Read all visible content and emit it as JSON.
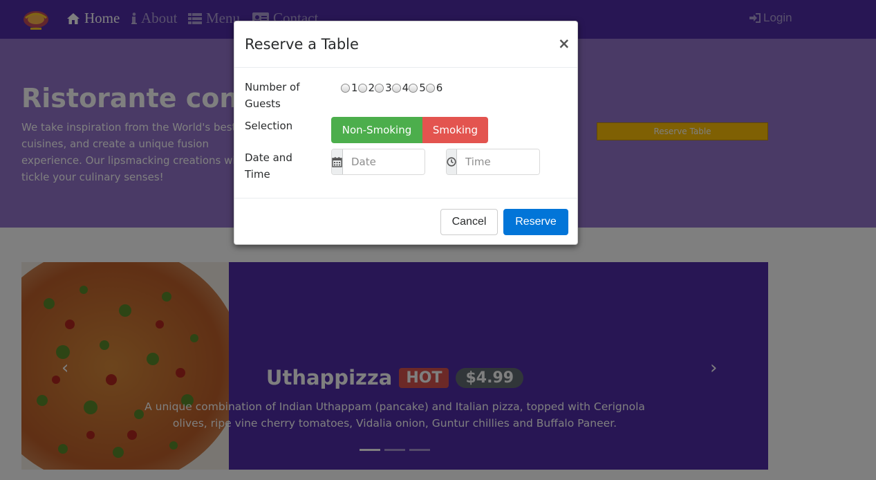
{
  "navbar": {
    "items": [
      {
        "label": "Home",
        "icon": "home-icon"
      },
      {
        "label": "About",
        "icon": "info-icon"
      },
      {
        "label": "Menu",
        "icon": "list-icon"
      },
      {
        "label": "Contact",
        "icon": "address-card-icon"
      }
    ],
    "login_label": "Login"
  },
  "hero": {
    "title": "Ristorante con Fusion",
    "text": "We take inspiration from the World's best cuisines, and create a unique fusion experience. Our lipsmacking creations will tickle your culinary senses!",
    "reserve_button": "Reserve Table"
  },
  "carousel": {
    "dish_name": "Uthappizza",
    "badge_hot": "HOT",
    "price": "$4.99",
    "description": "A unique combination of Indian Uthappam (pancake) and Italian pizza, topped with Cerignola olives, ripe vine cherry tomatoes, Vidalia onion, Guntur chillies and Buffalo Paneer.",
    "active_slide": 1,
    "slide_count": 3
  },
  "modal": {
    "title": "Reserve a Table",
    "close_symbol": "×",
    "guests_label": "Number of Guests",
    "guest_options": [
      "1",
      "2",
      "3",
      "4",
      "5",
      "6"
    ],
    "selection_label": "Selection",
    "non_smoking_label": "Non-Smoking",
    "smoking_label": "Smoking",
    "datetime_label": "Date and Time",
    "date_placeholder": "Date",
    "time_placeholder": "Time",
    "cancel_label": "Cancel",
    "reserve_label": "Reserve"
  },
  "colors": {
    "primary_dark": "#512da8",
    "primary_light": "#9575cd",
    "success": "#4cae4c",
    "danger": "#e3544f",
    "primary_button": "#0275d8",
    "warning": "#ffc107"
  }
}
